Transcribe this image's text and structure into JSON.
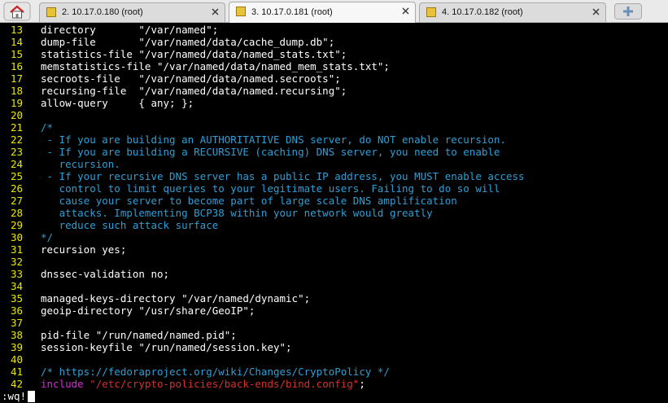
{
  "tabs": [
    {
      "label": "2. 10.17.0.180 (root)",
      "active": false
    },
    {
      "label": "3. 10.17.0.181 (root)",
      "active": true
    },
    {
      "label": "4. 10.17.0.182 (root)",
      "active": false
    }
  ],
  "icons": {
    "home": "home-icon",
    "tab": "session-icon",
    "close": "close-icon",
    "new_tab": "new-tab-icon"
  },
  "lines": [
    {
      "n": "13",
      "text": "directory       \"/var/named\";"
    },
    {
      "n": "14",
      "text": "dump-file       \"/var/named/data/cache_dump.db\";"
    },
    {
      "n": "15",
      "text": "statistics-file \"/var/named/data/named_stats.txt\";"
    },
    {
      "n": "16",
      "text": "memstatistics-file \"/var/named/data/named_mem_stats.txt\";"
    },
    {
      "n": "17",
      "text": "secroots-file   \"/var/named/data/named.secroots\";"
    },
    {
      "n": "18",
      "text": "recursing-file  \"/var/named/data/named.recursing\";"
    },
    {
      "n": "19",
      "text": "allow-query     { any; };"
    },
    {
      "n": "20",
      "text": ""
    },
    {
      "n": "21",
      "text": "/*",
      "cls": "c-comment"
    },
    {
      "n": "22",
      "text": " - If you are building an AUTHORITATIVE DNS server, do NOT enable recursion.",
      "cls": "c-comment"
    },
    {
      "n": "23",
      "text": " - If you are building a RECURSIVE (caching) DNS server, you need to enable",
      "cls": "c-comment"
    },
    {
      "n": "24",
      "text": "   recursion.",
      "cls": "c-comment"
    },
    {
      "n": "25",
      "text": " - If your recursive DNS server has a public IP address, you MUST enable access",
      "cls": "c-comment"
    },
    {
      "n": "26",
      "text": "   control to limit queries to your legitimate users. Failing to do so will",
      "cls": "c-comment"
    },
    {
      "n": "27",
      "text": "   cause your server to become part of large scale DNS amplification",
      "cls": "c-comment"
    },
    {
      "n": "28",
      "text": "   attacks. Implementing BCP38 within your network would greatly",
      "cls": "c-comment"
    },
    {
      "n": "29",
      "text": "   reduce such attack surface",
      "cls": "c-comment"
    },
    {
      "n": "30",
      "text": "*/",
      "cls": "c-comment"
    },
    {
      "n": "31",
      "text": "recursion yes;"
    },
    {
      "n": "32",
      "text": ""
    },
    {
      "n": "33",
      "text": "dnssec-validation no;"
    },
    {
      "n": "34",
      "text": ""
    },
    {
      "n": "35",
      "text": "managed-keys-directory \"/var/named/dynamic\";"
    },
    {
      "n": "36",
      "text": "geoip-directory \"/usr/share/GeoIP\";"
    },
    {
      "n": "37",
      "text": ""
    },
    {
      "n": "38",
      "text": "pid-file \"/run/named/named.pid\";"
    },
    {
      "n": "39",
      "text": "session-keyfile \"/run/named/session.key\";"
    },
    {
      "n": "40",
      "text": ""
    },
    {
      "n": "41",
      "text": "/* https://fedoraproject.org/wiki/Changes/CryptoPolicy */",
      "cls": "c-comment"
    },
    {
      "n": "42",
      "parts": [
        {
          "t": "include ",
          "cls": "c-include"
        },
        {
          "t": "\"/etc/crypto-policies/back-ends/bind.config\"",
          "cls": "c-str"
        },
        {
          "t": ";",
          "cls": "c-white"
        }
      ]
    }
  ],
  "command_line": ":wq!",
  "colors": {
    "background": "#000000",
    "line_numbers": "#e8e800",
    "comment": "#2e9fd6",
    "keyword": "#d62bd6",
    "string": "#d6302b"
  }
}
